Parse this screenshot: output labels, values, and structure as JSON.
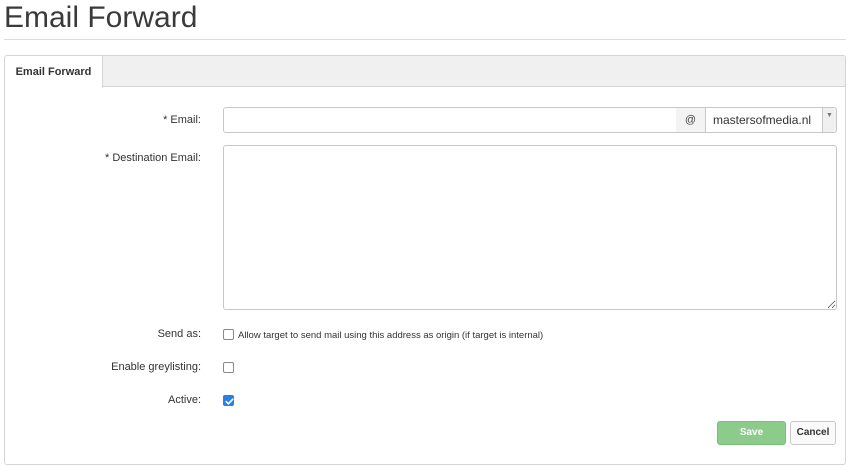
{
  "page": {
    "title": "Email Forward"
  },
  "tabs": [
    {
      "label": "Email Forward",
      "active": true
    }
  ],
  "form": {
    "email": {
      "label": "* Email:",
      "value": "",
      "addon": "@",
      "domain_selected": "mastersofmedia.nl"
    },
    "destination": {
      "label": "* Destination Email:",
      "value": ""
    },
    "send_as": {
      "label": "Send as:",
      "checkbox_text": "Allow target to send mail using this address as origin (if target is internal)",
      "checked": false
    },
    "greylisting": {
      "label": "Enable greylisting:",
      "checked": false
    },
    "active": {
      "label": "Active:",
      "checked": true
    }
  },
  "buttons": {
    "save": "Save",
    "cancel": "Cancel"
  },
  "colors": {
    "save_bg": "#8ccb8c",
    "checkbox_checked": "#2a7fe6"
  },
  "icons": {
    "select_arrow": "caret-down-icon",
    "checkmark": "checkmark-icon",
    "resize": "resize-grip-icon"
  }
}
